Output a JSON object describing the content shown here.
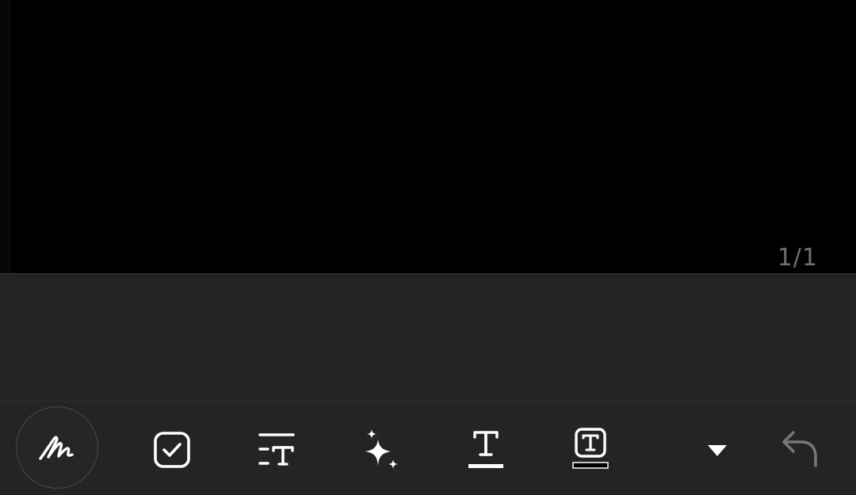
{
  "canvas": {
    "page_indicator": "1/1"
  },
  "toolbar": {
    "tools": [
      {
        "name": "pen",
        "icon": "handwriting-pen-icon",
        "selected": true
      },
      {
        "name": "checkbox",
        "icon": "checkbox-icon"
      },
      {
        "name": "text-style",
        "icon": "text-style-icon"
      },
      {
        "name": "ai-assist",
        "icon": "sparkles-icon"
      },
      {
        "name": "text-color",
        "icon": "text-color-icon"
      },
      {
        "name": "text-background",
        "icon": "text-background-icon"
      },
      {
        "name": "more",
        "icon": "dropdown-arrow-icon"
      },
      {
        "name": "undo",
        "icon": "undo-icon",
        "enabled": false
      }
    ]
  },
  "colors": {
    "canvas_bg": "#000000",
    "panel_bg": "#232323",
    "icon": "#ffffff",
    "disabled_icon": "#777777",
    "page_indicator": "#6f6f6f"
  }
}
